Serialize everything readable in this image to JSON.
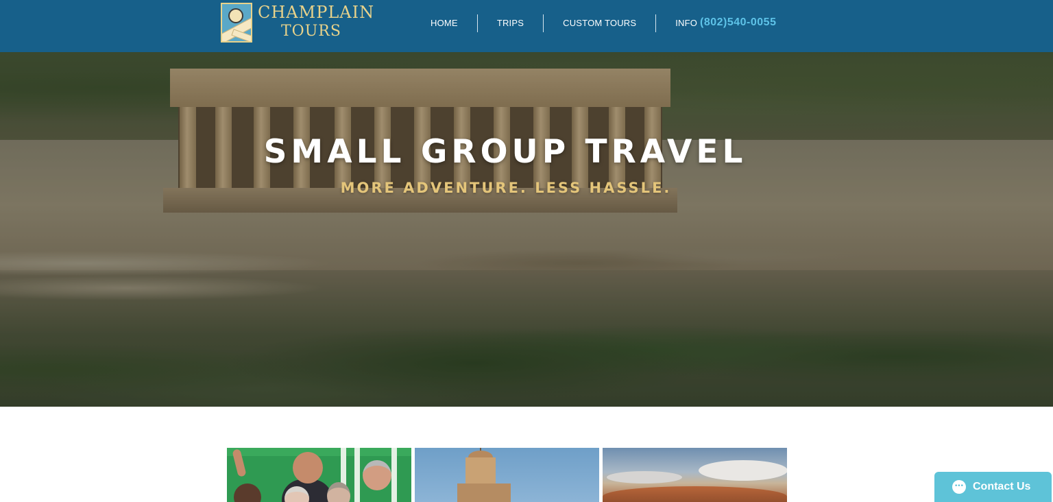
{
  "header": {
    "logo": {
      "line1": "CHAMPLAIN",
      "line2": "TOURS"
    },
    "nav": [
      {
        "label": "HOME"
      },
      {
        "label": "TRIPS"
      },
      {
        "label": "CUSTOM TOURS"
      },
      {
        "label": "INFO"
      }
    ],
    "phone": "(802)540-0055"
  },
  "hero": {
    "title": "SMALL GROUP TRAVEL",
    "subtitle": "MORE ADVENTURE. LESS HASSLE."
  },
  "cards": [
    {
      "image": "group-of-travelers-photo"
    },
    {
      "image": "church-dome-photo"
    },
    {
      "image": "mountain-landscape-photo"
    }
  ],
  "contact": {
    "label": "Contact Us",
    "icon": "chat-bubble-icon"
  },
  "colors": {
    "header_bg": "#17608a",
    "phone": "#5ec3e8",
    "hero_subtitle": "#e4c57a",
    "contact_bg": "#5ec3d8",
    "logo_gold": "#e8d28a"
  }
}
